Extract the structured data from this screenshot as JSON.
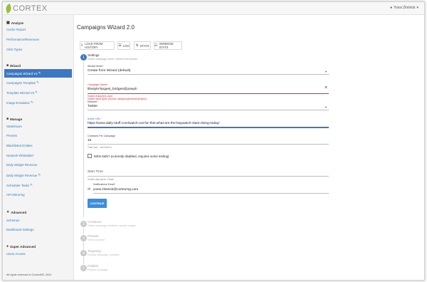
{
  "app": {
    "logo_text": "CORTEX"
  },
  "user": {
    "name": "Yossi Zlotnick",
    "icon": "person-icon",
    "caret": "▾"
  },
  "sidebar": {
    "sections": [
      {
        "title": "Analyze",
        "icon": "chart-icon"
      },
      {
        "title": "Wizard",
        "icon": "wizard-icon"
      },
      {
        "title": "Manage",
        "icon": "briefcase-icon"
      },
      {
        "title": "Advanced",
        "icon": "wrench-icon"
      },
      {
        "title": "Super Advanced",
        "icon": "person-icon"
      }
    ],
    "items": [
      {
        "label": "Cache Report"
      },
      {
        "label": "Performance/Revenues"
      },
      {
        "label": "Click Types"
      },
      {
        "label": "Campaigns Wizard V2",
        "active": true,
        "edit_icon": "pencil-icon"
      },
      {
        "label": "Campaigns Template",
        "edit_icon": "pencil-icon"
      },
      {
        "label": "Template Wizard V2",
        "edit_icon": "pencil-icon"
      },
      {
        "label": "Image Emulation",
        "edit_icon": "pencil-icon"
      },
      {
        "label": "Stats/Isues"
      },
      {
        "label": "Presets"
      },
      {
        "label": "Blacklisted Entities"
      },
      {
        "label": "Network Whitelabel"
      },
      {
        "label": "Daily Widget Revenue"
      },
      {
        "label": "Daily Widget Revenue",
        "edit_icon": "pencil-icon"
      },
      {
        "label": "Scheduler Tasks",
        "edit_icon": "pencil-icon"
      },
      {
        "label": "API Mirroring"
      },
      {
        "label": "Schemes"
      },
      {
        "label": "Dashboard Settings"
      },
      {
        "label": "Users Access"
      }
    ],
    "copyright": "All rights reserved to CortexWS, 2022"
  },
  "main": {
    "title": "Campaigns Wizard 2.0",
    "toolbar": [
      {
        "label": "LOAD FROM HISTORY",
        "icon": "upload-icon"
      },
      {
        "label": "LOG",
        "icon": "log-icon"
      },
      {
        "label": "STATS",
        "icon": "stats-icon"
      },
      {
        "label": "VERBOSE STATS",
        "icon": "verbose-stats-icon"
      }
    ],
    "steps": [
      {
        "number": "1",
        "title": "Settings",
        "subtitle": "Define campaign name, network and similar",
        "active": true
      },
      {
        "number": "2",
        "title": "Creatives",
        "subtitle": "Define campaign creatives, upload images"
      },
      {
        "number": "3",
        "title": "Presets",
        "subtitle": "Select a preset"
      },
      {
        "number": "4",
        "title": "Targeting",
        "subtitle": "Choose campaign countries"
      },
      {
        "number": "5",
        "title": "Publish",
        "subtitle": "Publish campaign"
      }
    ],
    "form": {
      "wizard_mode_label": "Wizard Mode",
      "wizard_mode_value": "Create from Wizard (default)",
      "campaign_name_label": "Campaign Name",
      "campaign_name_value": "lifestyle*largest_bridges@joseph",
      "campaign_name_errors": [
        "Invalid characters used",
        "Invalid name given (format: category@network@name)"
      ],
      "network_label": "Network",
      "network_value": "Twitter",
      "article_url_label": "Article URL",
      "article_url_value": "https://www.daily-stuff.com/watch-out-for-this-what-are-the-baywatch-stars-doing-today/",
      "creatives_label": "Creatives Per Campaign",
      "creatives_value": "10",
      "creatives_help": "Total (ad) - use bold to",
      "msn_safe_label": "MSN Safe? (currently disabled, requires some testing)",
      "start_time_label": "Start Time",
      "start_time_help": "Invalid date given. Reset",
      "notification_email_label": "Notifications Email",
      "notification_email_value": "yossi.zlotnick@cortexmg.com",
      "continue_label": "CONTINUE"
    }
  }
}
